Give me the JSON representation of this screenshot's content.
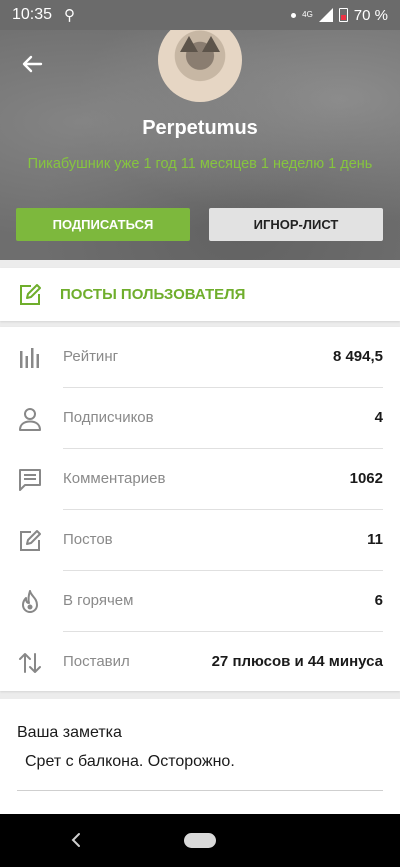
{
  "status_bar": {
    "time": "10:35",
    "network": "4G",
    "battery": "70 %"
  },
  "profile": {
    "username": "Perpetumus",
    "member_since": "Пикабушник уже 1 год 11 месяцев 1 неделю 1 день",
    "subscribe_label": "ПОДПИСАТЬСЯ",
    "ignore_label": "ИГНОР-ЛИСТ"
  },
  "posts_link": {
    "label": "ПОСТЫ ПОЛЬЗОВАТЕЛЯ"
  },
  "stats": [
    {
      "icon": "bar-chart-icon",
      "label": "Рейтинг",
      "value": "8 494,5"
    },
    {
      "icon": "person-icon",
      "label": "Подписчиков",
      "value": "4"
    },
    {
      "icon": "comment-icon",
      "label": "Комментариев",
      "value": "1062"
    },
    {
      "icon": "edit-icon",
      "label": "Постов",
      "value": "11"
    },
    {
      "icon": "flame-icon",
      "label": "В горячем",
      "value": "6"
    },
    {
      "icon": "swap-vertical-icon",
      "label": "Поставил",
      "value": "27 плюсов и 44 минуса"
    }
  ],
  "note": {
    "title": "Ваша заметка",
    "text": "Срет с балкона. Осторожно."
  },
  "colors": {
    "accent_green": "#7db83d",
    "header_gray": "#6e6e6e"
  }
}
